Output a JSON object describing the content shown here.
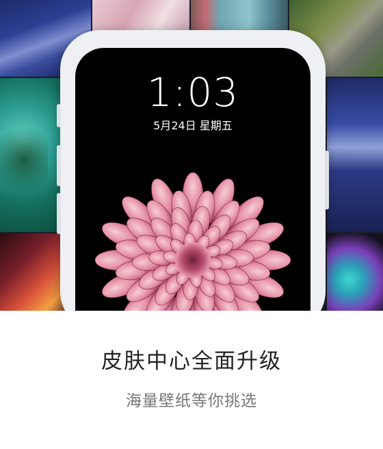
{
  "lockscreen": {
    "time": "1:03",
    "date": "5月24日 星期五"
  },
  "promo": {
    "headline": "皮肤中心全面升级",
    "subline": "海量壁纸等你挑选"
  },
  "colors": {
    "background": "#ffffff",
    "headline_text": "#222222",
    "subline_text": "#777777",
    "phone_frame": "#eef0f3",
    "screen": "#000000",
    "flower_pink": "#d9708f"
  },
  "wallpapers": [
    "sea-wallpaper",
    "pink-wallpaper",
    "door-wallpaper",
    "train-wallpaper",
    "lagoon-wallpaper",
    "memorial-wallpaper",
    "canyon-wallpaper",
    "paint-splash-wallpaper",
    "dahlia-wallpaper"
  ]
}
